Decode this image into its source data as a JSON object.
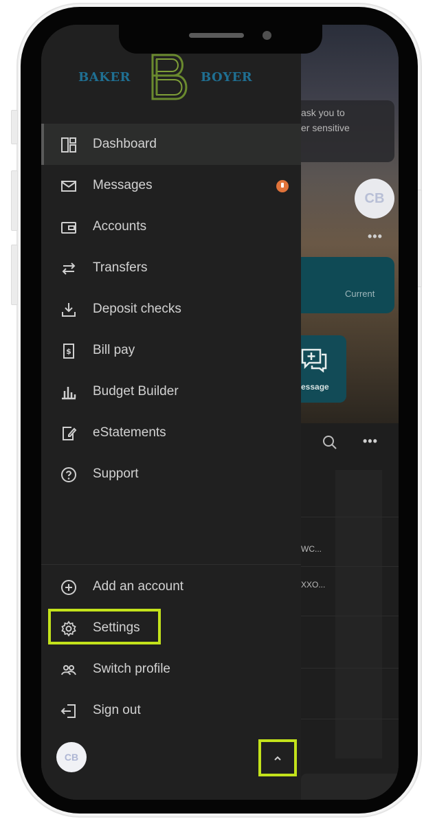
{
  "brand": {
    "left": "BAKER",
    "right": "BOYER",
    "monogram": "B"
  },
  "nav": {
    "items": [
      {
        "key": "dashboard",
        "label": "Dashboard",
        "icon": "dashboard-icon",
        "active": true
      },
      {
        "key": "messages",
        "label": "Messages",
        "icon": "envelope-icon",
        "badge": true
      },
      {
        "key": "accounts",
        "label": "Accounts",
        "icon": "wallet-icon"
      },
      {
        "key": "transfers",
        "label": "Transfers",
        "icon": "transfer-arrows-icon"
      },
      {
        "key": "deposit-checks",
        "label": "Deposit checks",
        "icon": "download-tray-icon"
      },
      {
        "key": "bill-pay",
        "label": "Bill pay",
        "icon": "bill-dollar-icon"
      },
      {
        "key": "budget-builder",
        "label": "Budget Builder",
        "icon": "bar-chart-icon"
      },
      {
        "key": "estatements",
        "label": "eStatements",
        "icon": "document-edit-icon"
      },
      {
        "key": "support",
        "label": "Support",
        "icon": "help-circle-icon"
      }
    ],
    "footer": [
      {
        "key": "add-account",
        "label": "Add an account",
        "icon": "plus-circle-icon"
      },
      {
        "key": "settings",
        "label": "Settings",
        "icon": "gear-icon",
        "highlighted": true
      },
      {
        "key": "switch-profile",
        "label": "Switch profile",
        "icon": "users-icon"
      },
      {
        "key": "sign-out",
        "label": "Sign out",
        "icon": "sign-out-icon"
      }
    ]
  },
  "profile": {
    "initials": "CB"
  },
  "background": {
    "notice_line1": "ask you to",
    "notice_line2": "er sensitive",
    "avatar_initials": "CB",
    "account_tag": "Current",
    "message_label": "essage",
    "row1": "WC...",
    "row2": "XXO..."
  },
  "colors": {
    "highlight": "#c3e21b",
    "badge": "#e0733a",
    "brand_blue": "#1f6f92",
    "brand_green": "#6a8a2e"
  }
}
